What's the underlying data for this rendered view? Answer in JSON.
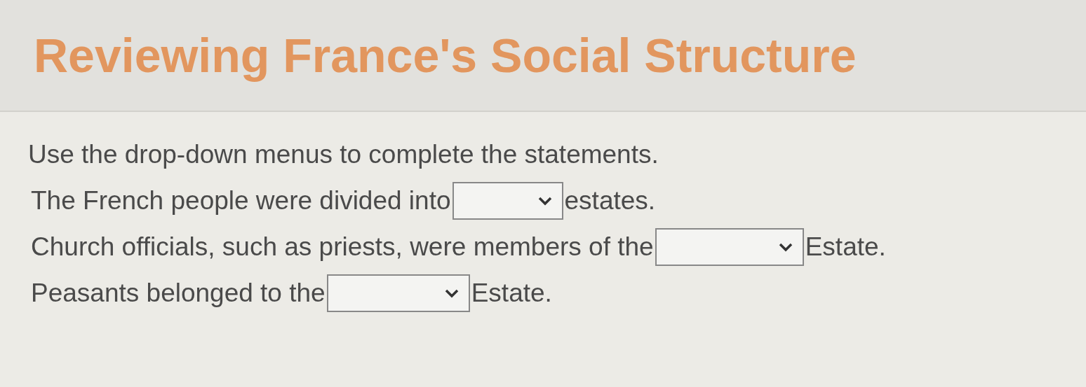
{
  "title": "Reviewing France's Social Structure",
  "instructions": "Use the drop-down menus to complete the statements.",
  "statements": [
    {
      "before": "The French people were divided into",
      "after": "estates."
    },
    {
      "before": "Church officials, such as priests, were members of the",
      "after": "Estate."
    },
    {
      "before": "Peasants belonged to the",
      "after": "Estate."
    }
  ]
}
